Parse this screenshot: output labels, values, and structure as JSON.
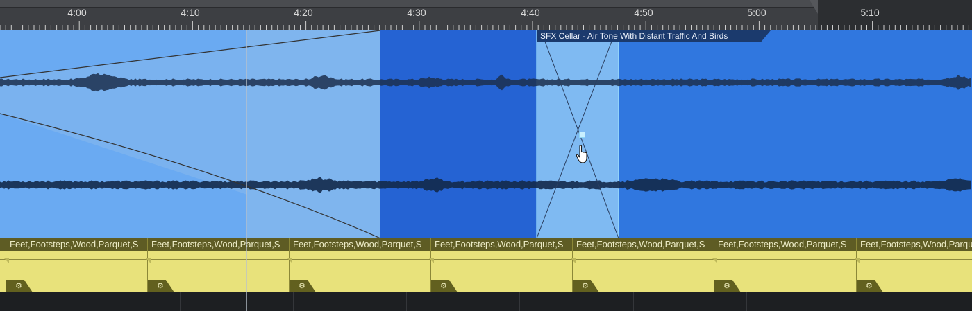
{
  "ruler": {
    "labels": [
      "4:00",
      "4:10",
      "4:20",
      "4:30",
      "4:40",
      "4:50",
      "5:00",
      "5:10"
    ]
  },
  "audio_clip": {
    "title": "SFX Cellar - Air Tone With Distant Traffic And Birds"
  },
  "midi_clips": [
    {
      "label": "Feet,Footsteps,Wood,Parquet,S"
    },
    {
      "label": "Feet,Footsteps,Wood,Parquet,S"
    },
    {
      "label": "Feet,Footsteps,Wood,Parquet,S"
    },
    {
      "label": "Feet,Footsteps,Wood,Parquet,S"
    },
    {
      "label": "Feet,Footsteps,Wood,Parquet,S"
    },
    {
      "label": "Feet,Footsteps,Wood,Parquet,S"
    },
    {
      "label": "Feet,Footsteps,Wood,Parquet,S"
    }
  ],
  "icons": {
    "clip_settings": "gear-icon",
    "cursor": "hand-pointer-icon"
  },
  "colors": {
    "audio_light": "#6aaaf2",
    "audio_selected": "#2563d3",
    "audio_main": "#3077df",
    "midi_clip": "#e8e27b"
  }
}
